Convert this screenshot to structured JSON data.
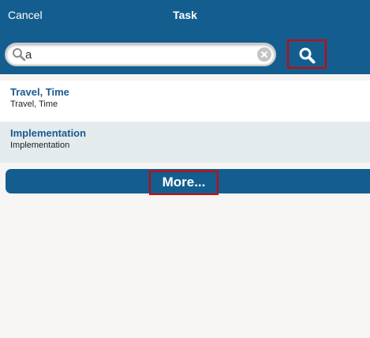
{
  "header": {
    "cancel_label": "Cancel",
    "title": "Task"
  },
  "search": {
    "value": "a",
    "placeholder": "",
    "icon": "search-icon",
    "clear_icon": "clear-icon"
  },
  "results": [
    {
      "title": "Travel, Time",
      "subtitle": "Travel, Time"
    },
    {
      "title": "Implementation",
      "subtitle": "Implementation"
    }
  ],
  "more_label": "More...",
  "colors": {
    "header_bg": "#135e8f",
    "link_text": "#1d5a8e",
    "alt_row": "#e3ebed",
    "highlight_outline": "#d60000",
    "page_bg": "#f6f5f3"
  }
}
